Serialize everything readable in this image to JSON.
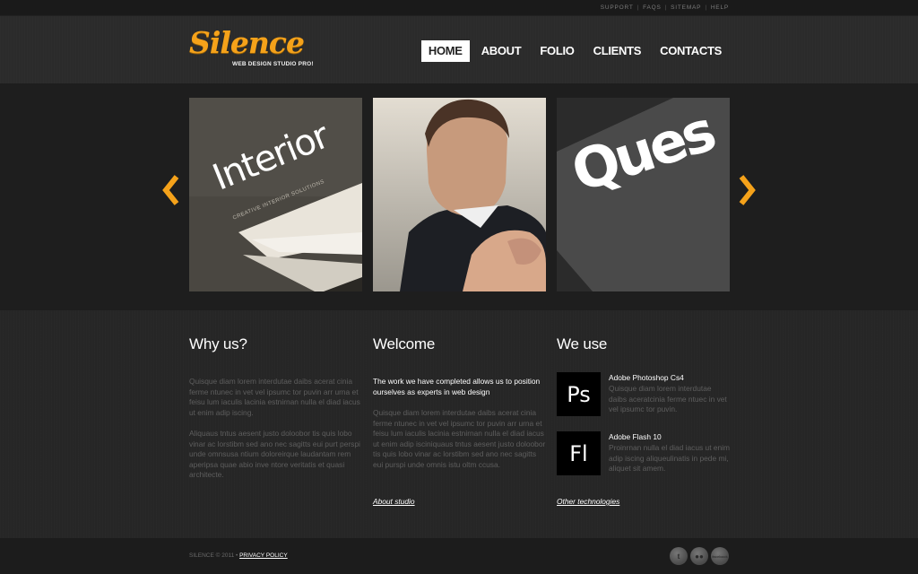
{
  "top_links": [
    "SUPPORT",
    "FAQS",
    "SITEMAP",
    "HELP"
  ],
  "logo": {
    "name": "Silence",
    "tagline": "WEB DESIGN STUDIO PRO!"
  },
  "nav": [
    {
      "label": "HOME",
      "active": true
    },
    {
      "label": "ABOUT",
      "active": false
    },
    {
      "label": "FOLIO",
      "active": false
    },
    {
      "label": "CLIENTS",
      "active": false
    },
    {
      "label": "CONTACTS",
      "active": false
    }
  ],
  "slider": {
    "slides": [
      {
        "title": "Interior",
        "subtitle": "CREATIVE INTERIOR SOLUTIONS"
      },
      {
        "title": ""
      },
      {
        "title": "Ques"
      }
    ]
  },
  "why_us": {
    "heading": "Why us?",
    "p1": "Quisque diam lorem interdutae daibs acerat cinia ferme ntunec in vet vel ipsumc tor puvin arr urna et feisu lum iaculis lacinia estnirnan nulla el diad iacus ut enim adip iscing.",
    "p2": "Aliquaus tntus aesent justo doloobor tis quis lobo vinar ac lorstibm sed ano nec sagitts eui purt perspi unde omnsusa ntium doloreirque laudantam rem aperipsa quae abio inve ntore veritatis et quasi architecte."
  },
  "welcome": {
    "heading": "Welcome",
    "lead": "The work we have completed allows us to position ourselves as experts in web design",
    "p": "Quisque diam lorem interdutae daibs acerat cinia ferme ntunec in vet vel ipsumc tor puvin arr urna et feisu lum iaculis lacinia estnirnan nulla el diad iacus ut enim adip isciniquaus tntus aesent justo doloobor tis quis lobo vinar ac lorstibm sed ano nec sagitts eui purspi unde omnis istu oltm ccusa.",
    "link": "About studio"
  },
  "we_use": {
    "heading": "We use",
    "items": [
      {
        "icon": "Ps",
        "name": "Adobe Photoshop Cs4",
        "desc": "Quisque diam lorem interdutae daibs aceratcinia ferme ntuec in vet vel ipsumc tor puvin."
      },
      {
        "icon": "Fl",
        "name": "Adobe Flash 10",
        "desc": "Proinrnan nulla el diad iacus ut enim adip iscing aliqueulinatis in pede mi, aliquet sit amem."
      }
    ],
    "link": "Other technologies"
  },
  "footer": {
    "copyright": "SILENCE © 2011 •",
    "privacy": "PRIVACY POLICY",
    "social": [
      "twitter",
      "flickr",
      "facebook"
    ],
    "social_fb_label": "facebook"
  },
  "colors": {
    "accent": "#f5a21a",
    "background": "#262626"
  }
}
